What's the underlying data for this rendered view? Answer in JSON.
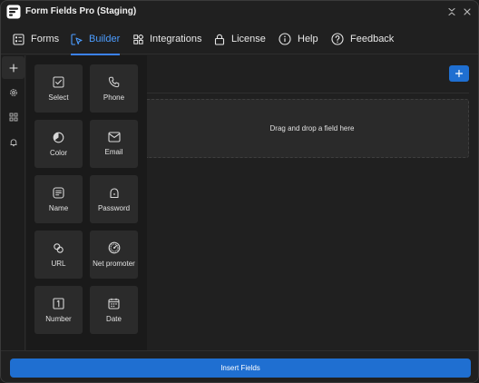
{
  "window": {
    "title": "Form Fields Pro (Staging)"
  },
  "nav": {
    "tabs": [
      {
        "label": "Forms",
        "icon": "forms-icon"
      },
      {
        "label": "Builder",
        "icon": "cursor-icon",
        "active": true
      },
      {
        "label": "Integrations",
        "icon": "integrations-icon"
      },
      {
        "label": "License",
        "icon": "lock-icon"
      },
      {
        "label": "Help",
        "icon": "info-icon"
      },
      {
        "label": "Feedback",
        "icon": "question-icon"
      }
    ]
  },
  "rail": {
    "items": [
      {
        "icon": "plus-icon",
        "active": true
      },
      {
        "icon": "gear-icon"
      },
      {
        "icon": "grid-icon"
      },
      {
        "icon": "bell-icon"
      }
    ]
  },
  "fields": [
    {
      "label": "Select",
      "icon": "checkbox-icon"
    },
    {
      "label": "Phone",
      "icon": "phone-icon"
    },
    {
      "label": "Color",
      "icon": "color-icon"
    },
    {
      "label": "Email",
      "icon": "mail-icon"
    },
    {
      "label": "Name",
      "icon": "name-icon"
    },
    {
      "label": "Password",
      "icon": "password-icon"
    },
    {
      "label": "URL",
      "icon": "link-icon"
    },
    {
      "label": "Net promoter",
      "icon": "gauge-icon"
    },
    {
      "label": "Number",
      "icon": "number-icon"
    },
    {
      "label": "Date",
      "icon": "calendar-icon"
    }
  ],
  "canvas": {
    "dropzone_text": "Drag and drop a field here"
  },
  "footer": {
    "insert_label": "Insert Fields"
  },
  "colors": {
    "accent": "#1f6fd1",
    "active_tab": "#4c9dff",
    "background": "#202020",
    "card": "#2b2b2b"
  }
}
